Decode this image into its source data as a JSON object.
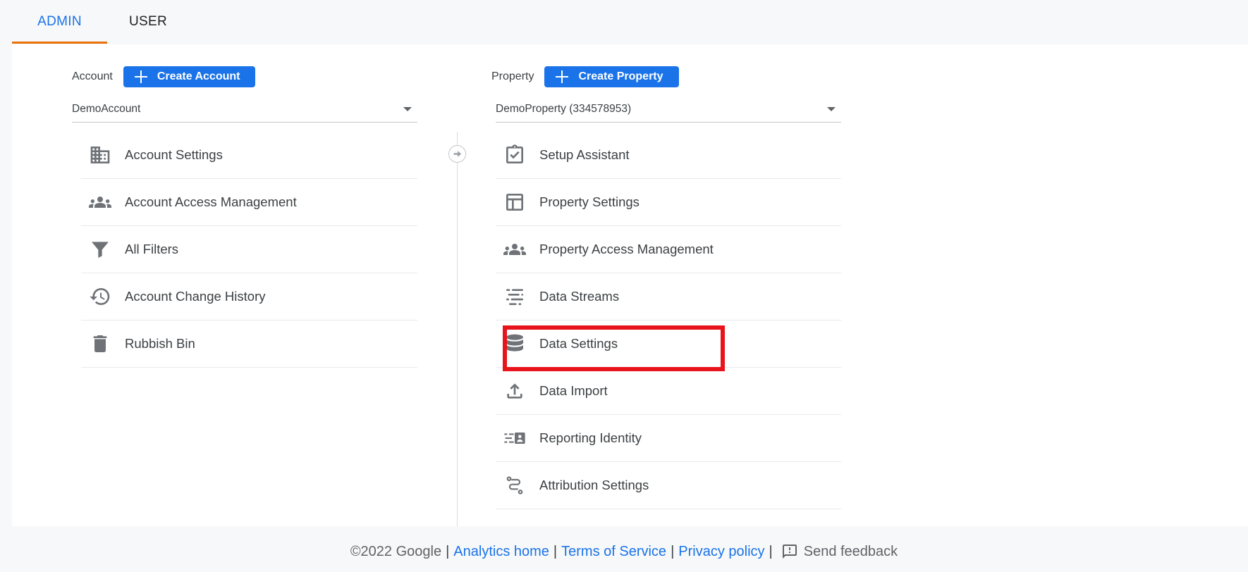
{
  "tabs": {
    "admin": "ADMIN",
    "user": "USER"
  },
  "account": {
    "label": "Account",
    "create_label": "Create Account",
    "selected": "DemoAccount",
    "items": [
      {
        "label": "Account Settings",
        "icon": "building-icon"
      },
      {
        "label": "Account Access Management",
        "icon": "people-icon"
      },
      {
        "label": "All Filters",
        "icon": "filter-icon"
      },
      {
        "label": "Account Change History",
        "icon": "history-icon"
      },
      {
        "label": "Rubbish Bin",
        "icon": "trash-icon"
      }
    ]
  },
  "property": {
    "label": "Property",
    "create_label": "Create Property",
    "selected": "DemoProperty (334578953)",
    "items": [
      {
        "label": "Setup Assistant",
        "icon": "clipboard-check-icon"
      },
      {
        "label": "Property Settings",
        "icon": "layout-icon"
      },
      {
        "label": "Property Access Management",
        "icon": "people-icon"
      },
      {
        "label": "Data Streams",
        "icon": "data-streams-icon"
      },
      {
        "label": "Data Settings",
        "icon": "database-icon"
      },
      {
        "label": "Data Import",
        "icon": "upload-icon"
      },
      {
        "label": "Reporting Identity",
        "icon": "reporting-identity-icon"
      },
      {
        "label": "Attribution Settings",
        "icon": "attribution-icon"
      }
    ]
  },
  "footer": {
    "copyright": "©2022 Google",
    "links": [
      "Analytics home",
      "Terms of Service",
      "Privacy policy"
    ],
    "feedback": "Send feedback"
  },
  "colors": {
    "accent": "#1a73e8",
    "tab_underline": "#e8710a",
    "highlight": "#e8141c"
  }
}
